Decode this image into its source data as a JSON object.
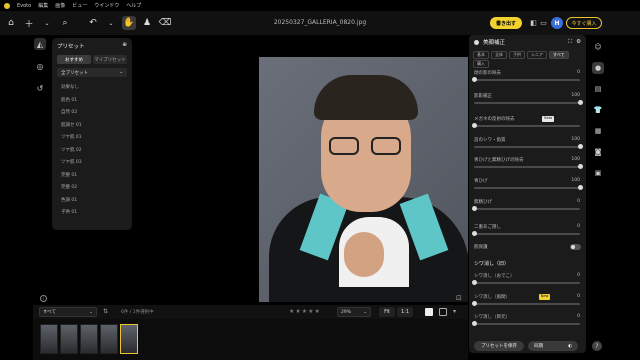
{
  "menubar": {
    "app": "Evoto",
    "items": [
      "編集",
      "画像",
      "ビュー",
      "ウインドウ",
      "ヘルプ"
    ]
  },
  "topbar": {
    "filename": "20250327_GALLERIA_0820.jpg",
    "export_label": "書き出す",
    "avatar_letter": "H",
    "try_label": "今すぐ購入"
  },
  "preset_panel": {
    "title": "プリセット",
    "tabs": [
      "おすすめ",
      "マイプリセット"
    ],
    "dropdown": "全プリセット",
    "items": [
      "効果なし",
      "肌色 01",
      "自然 02",
      "肌調せ 01",
      "ツヤ肌 01",
      "ツヤ肌 02",
      "ツヤ肌 03",
      "完璧 01",
      "完璧 02",
      "色調 01",
      "子供 01"
    ]
  },
  "filmbar": {
    "filter": "すべて",
    "count": "6件 / 1件選択中",
    "stars": "★★★★★",
    "zoom": "29%",
    "fit": "Fit",
    "one": "1:1"
  },
  "right_panel": {
    "title": "美顔補正",
    "tabs": [
      "基本",
      "全体",
      "子供",
      "シニア",
      "すべて",
      "購入"
    ],
    "sliders": [
      {
        "label": "顔の影の除去",
        "value": "0",
        "fraction": 0.0
      },
      {
        "label": "影影補正",
        "value": "100",
        "fraction": 1.0
      },
      {
        "label": "メガネの反射の除去",
        "badge": "Beta",
        "value": "",
        "fraction": 0.0
      },
      {
        "label": "首のシワ・角質",
        "value": "100",
        "fraction": 1.0
      },
      {
        "label": "青ひげと無精ひげの除去",
        "value": "100",
        "fraction": 1.0
      },
      {
        "label": "青ひげ",
        "value": "100",
        "fraction": 1.0
      },
      {
        "label": "無精ひげ",
        "value": "0",
        "fraction": 0.0
      },
      {
        "label": "二重あご隠し",
        "value": "0",
        "fraction": 0.0
      }
    ],
    "toggle_label": "肌保護",
    "section": "シワ消し（旧）",
    "sliders2": [
      {
        "label": "シワ消し（おでこ）",
        "value": "0",
        "fraction": 0.0
      },
      {
        "label": "シワ消し（眉間）",
        "badge": "New",
        "value": "0",
        "fraction": 0.0
      },
      {
        "label": "シワ消し（目元）",
        "value": "0",
        "fraction": 0.0
      }
    ],
    "save_preset": "プリセットを保存",
    "sync": "同期"
  }
}
